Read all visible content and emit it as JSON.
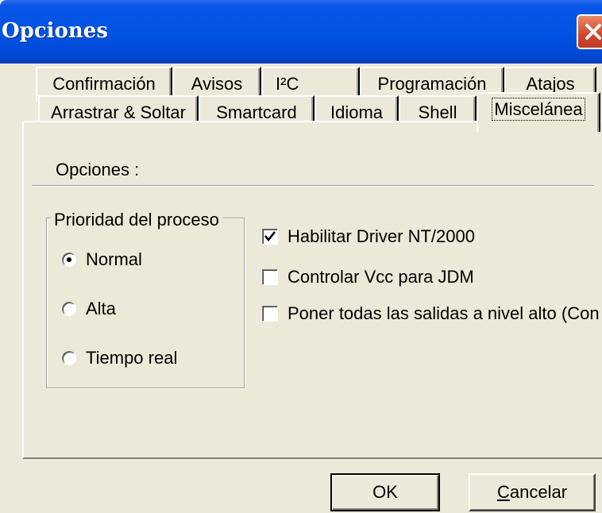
{
  "window": {
    "title": "Opciones"
  },
  "tabs_row_back": [
    {
      "label": "Confirmación"
    },
    {
      "label": "Avisos"
    },
    {
      "label": "I²C"
    },
    {
      "label": "Programación"
    },
    {
      "label": "Atajos"
    }
  ],
  "tabs_row_front": [
    {
      "label": "Arrastrar & Soltar"
    },
    {
      "label": "Smartcard"
    },
    {
      "label": "Idioma"
    },
    {
      "label": "Shell"
    },
    {
      "label": "Miscelánea",
      "active": true
    }
  ],
  "panel": {
    "section_label": "Opciones :",
    "priority_group": {
      "title": "Prioridad del proceso",
      "options": [
        {
          "label": "Normal",
          "selected": true
        },
        {
          "label": "Alta",
          "selected": false
        },
        {
          "label": "Tiempo real",
          "selected": false
        }
      ]
    },
    "checkboxes": [
      {
        "label": "Habilitar Driver NT/2000",
        "checked": true
      },
      {
        "label": "Controlar Vcc para JDM",
        "checked": false
      },
      {
        "label": "Poner todas las salidas a nivel alto (Con",
        "checked": false
      }
    ]
  },
  "buttons": {
    "ok": "OK",
    "cancel_first": "C",
    "cancel_rest": "ancelar"
  },
  "colors": {
    "titlebar": "#0054e3",
    "dialog_bg": "#ece9d8",
    "close": "#d1462c"
  }
}
